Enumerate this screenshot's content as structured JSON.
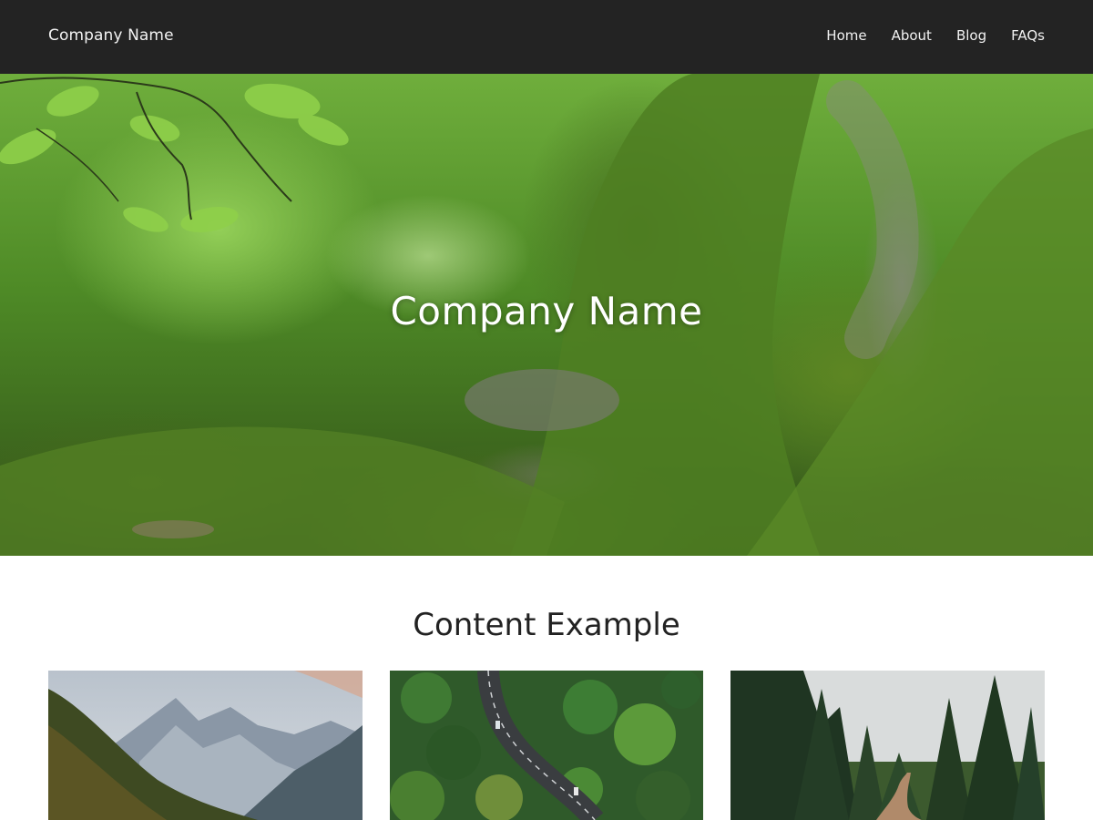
{
  "navbar": {
    "brand": "Company Name",
    "links": [
      {
        "label": "Home"
      },
      {
        "label": "About"
      },
      {
        "label": "Blog"
      },
      {
        "label": "FAQs"
      }
    ]
  },
  "hero": {
    "title": "Company Name",
    "image": "mossy-tree-roots-forest"
  },
  "content": {
    "section_title": "Content Example",
    "cards": [
      {
        "image": "mountain-forest-valley"
      },
      {
        "image": "aerial-winding-road-forest"
      },
      {
        "image": "pine-forest-dirt-path"
      }
    ]
  },
  "colors": {
    "navbar_bg": "#232323",
    "nav_text": "#f2f2f2",
    "page_bg": "#ffffff"
  }
}
